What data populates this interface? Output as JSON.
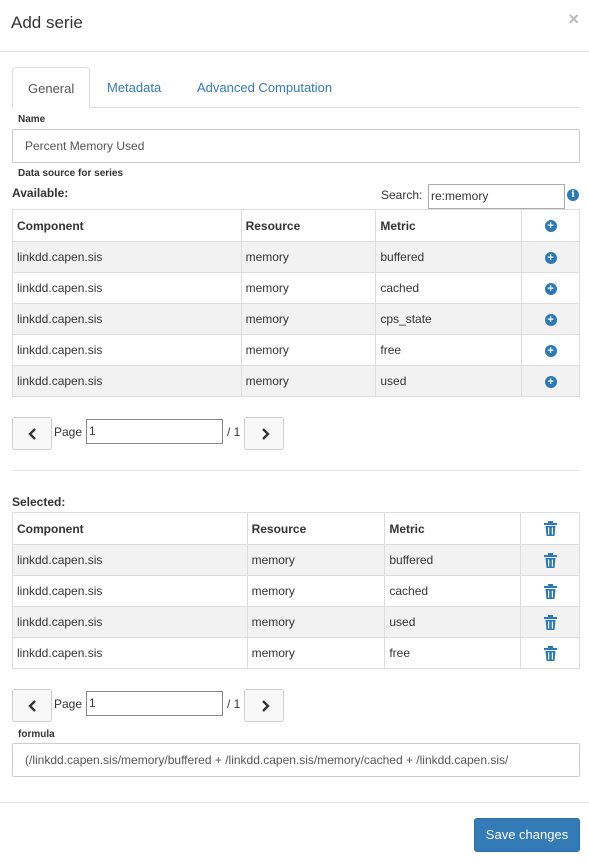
{
  "modal": {
    "title": "Add serie",
    "close_label": "×"
  },
  "tabs": [
    {
      "label": "General",
      "active": true
    },
    {
      "label": "Metadata",
      "active": false
    },
    {
      "label": "Advanced Computation",
      "active": false
    }
  ],
  "name_field": {
    "label": "Name",
    "value": "Percent Memory Used"
  },
  "datasource": {
    "label": "Data source for series",
    "available_label": "Available:",
    "search_label": "Search:",
    "search_value": "re:memory",
    "columns": [
      "Component",
      "Resource",
      "Metric"
    ],
    "rows": [
      {
        "component": "linkdd.capen.sis",
        "resource": "memory",
        "metric": "buffered"
      },
      {
        "component": "linkdd.capen.sis",
        "resource": "memory",
        "metric": "cached"
      },
      {
        "component": "linkdd.capen.sis",
        "resource": "memory",
        "metric": "cps_state"
      },
      {
        "component": "linkdd.capen.sis",
        "resource": "memory",
        "metric": "free"
      },
      {
        "component": "linkdd.capen.sis",
        "resource": "memory",
        "metric": "used"
      }
    ],
    "pager": {
      "page_label": "Page",
      "page_value": "1",
      "total": "/ 1"
    }
  },
  "selected": {
    "label": "Selected:",
    "columns": [
      "Component",
      "Resource",
      "Metric"
    ],
    "rows": [
      {
        "component": "linkdd.capen.sis",
        "resource": "memory",
        "metric": "buffered"
      },
      {
        "component": "linkdd.capen.sis",
        "resource": "memory",
        "metric": "cached"
      },
      {
        "component": "linkdd.capen.sis",
        "resource": "memory",
        "metric": "used"
      },
      {
        "component": "linkdd.capen.sis",
        "resource": "memory",
        "metric": "free"
      }
    ],
    "pager": {
      "page_label": "Page",
      "page_value": "1",
      "total": "/ 1"
    }
  },
  "formula": {
    "label": "formula",
    "value": "(/linkdd.capen.sis/memory/buffered + /linkdd.capen.sis/memory/cached + /linkdd.capen.sis/"
  },
  "footer": {
    "save_label": "Save changes"
  },
  "colors": {
    "accent": "#337ab7",
    "icon_blue": "#2a7ab8"
  },
  "icons": {
    "add": "plus-circle-icon",
    "remove": "trash-icon",
    "info": "info-icon",
    "prev": "chevron-left-icon",
    "next": "chevron-right-icon"
  }
}
